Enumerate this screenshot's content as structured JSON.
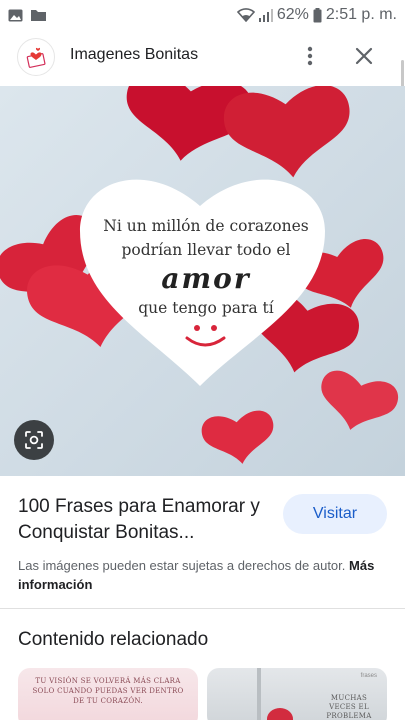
{
  "status_bar": {
    "battery": "62%",
    "time": "2:51 p. m."
  },
  "header": {
    "title": "Imagenes Bonitas"
  },
  "image_text": {
    "line1": "Ni un millón de corazones",
    "line2": "podrían llevar todo el",
    "line3": "amor",
    "line4": "que tengo para tí"
  },
  "result": {
    "title": "100 Frases para Enamorar y Conquistar Bonitas...",
    "visit_label": "Visitar",
    "copyright": "Las imágenes pueden estar sujetas a derechos de autor.",
    "more_info": "Más información"
  },
  "related": {
    "title": "Contenido relacionado",
    "thumb1_text": "Tu visión se volverá más clara solo cuando puedas ver dentro de tu corazón.",
    "thumb2_brand": "frases",
    "thumb2_text": "Muchas veces el problema está en que tu"
  },
  "colors": {
    "accent": "#1a5dc9",
    "heart_red": "#d8253a",
    "visit_bg": "#e8f0fe"
  },
  "icons": [
    "gallery-icon",
    "folder-icon",
    "wifi-icon",
    "signal-icon",
    "battery-icon",
    "more-vert-icon",
    "close-icon",
    "lens-icon"
  ]
}
